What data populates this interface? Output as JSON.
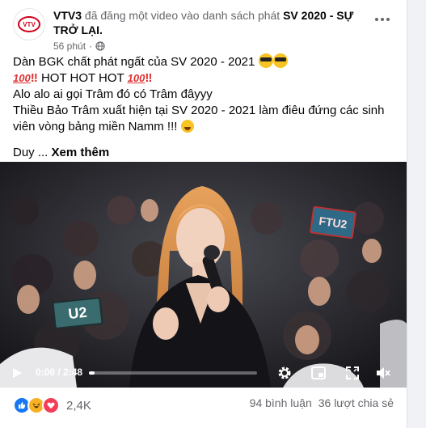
{
  "post": {
    "page_name": "VTV3",
    "action_text": "đã đăng một video vào danh sách phát",
    "playlist_name": "SV 2020 - SỰ TRỞ LẠI.",
    "time_ago": "56 phút",
    "avatar_label": "VTV3",
    "lines": {
      "line1": "Dàn BGK chất phát ngất của SV 2020 - 2021",
      "line2": "HOT HOT HOT",
      "line3": "Alo alo ai gọi Trâm đó có Trâm đâyyy",
      "line4": "Thiều Bảo Trâm xuất hiện tại SV 2020 - 2021 làm điêu đứng các sinh viên vòng bảng miền Namm !!!",
      "line5_prefix": "Duy ...",
      "see_more": "Xem thêm"
    },
    "emoji": {
      "hundred": "100"
    }
  },
  "video": {
    "current_time": "0:06",
    "duration": "2:48",
    "time_separator": " / ",
    "progress": 0.036,
    "sign_left": "U2",
    "sign_right": "FTU2"
  },
  "footer": {
    "reaction_count": "2,4K",
    "comments": "94 bình luận",
    "shares": "36 lượt chia sẻ"
  },
  "colors": {
    "text": "#050505",
    "muted": "#65676b",
    "like_blue": "#1877f2",
    "love_red": "#f33e58",
    "haha_yellow": "#f7b125",
    "vtv_red": "#d0021b"
  },
  "icons": [
    "globe-icon",
    "more-options-icon",
    "play-icon",
    "settings-icon",
    "picture-in-picture-icon",
    "fullscreen-icon",
    "volume-icon",
    "like-icon",
    "haha-icon",
    "love-icon"
  ]
}
